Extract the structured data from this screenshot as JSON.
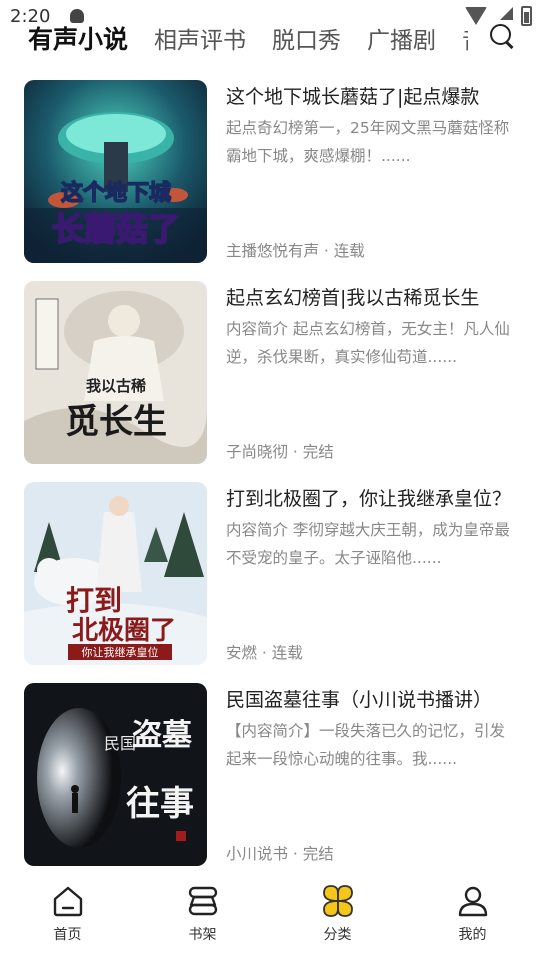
{
  "status": {
    "time": "2:20"
  },
  "tabs": [
    {
      "label": "有声小说",
      "active": true
    },
    {
      "label": "相声评书",
      "active": false
    },
    {
      "label": "脱口秀",
      "active": false
    },
    {
      "label": "广播剧",
      "active": false
    },
    {
      "label": "音",
      "active": false
    }
  ],
  "books": [
    {
      "title": "这个地下城长蘑菇了|起点爆款",
      "description": "起点奇幻榜第一，25年网文黑马蘑菇怪称霸地下城，爽感爆棚！......",
      "meta": "主播悠悦有声 · 连载",
      "cover_text": [
        "这个地下城",
        "长蘑菇了"
      ]
    },
    {
      "title": "起点玄幻榜首|我以古稀觅长生",
      "description": "内容简介 起点玄幻榜首，无女主！凡人仙逆，杀伐果断，真实修仙苟道......",
      "meta": "子尚晓彻 · 完结",
      "cover_text": [
        "我以古稀",
        "觅长生"
      ]
    },
    {
      "title": "打到北极圈了，你让我继承皇位？",
      "description": "内容简介 李彻穿越大庆王朝，成为皇帝最不受宠的皇子。太子诬陷他......",
      "meta": "安燃 · 连载",
      "cover_text": [
        "打到",
        "北极圈了",
        "你让我继承皇位"
      ]
    },
    {
      "title": "民国盗墓往事（小川说书播讲）",
      "description": "【内容简介】一段失落已久的记忆，引发起来一段惊心动魄的往事。我......",
      "meta": "小川说书 · 完结",
      "cover_text": [
        "民国",
        "盗墓",
        "往事"
      ]
    }
  ],
  "nav": [
    {
      "label": "首页",
      "icon": "home-icon"
    },
    {
      "label": "书架",
      "icon": "bookshelf-icon"
    },
    {
      "label": "分类",
      "icon": "category-icon",
      "active": true,
      "color": "#f5c518"
    },
    {
      "label": "我的",
      "icon": "profile-icon"
    }
  ]
}
